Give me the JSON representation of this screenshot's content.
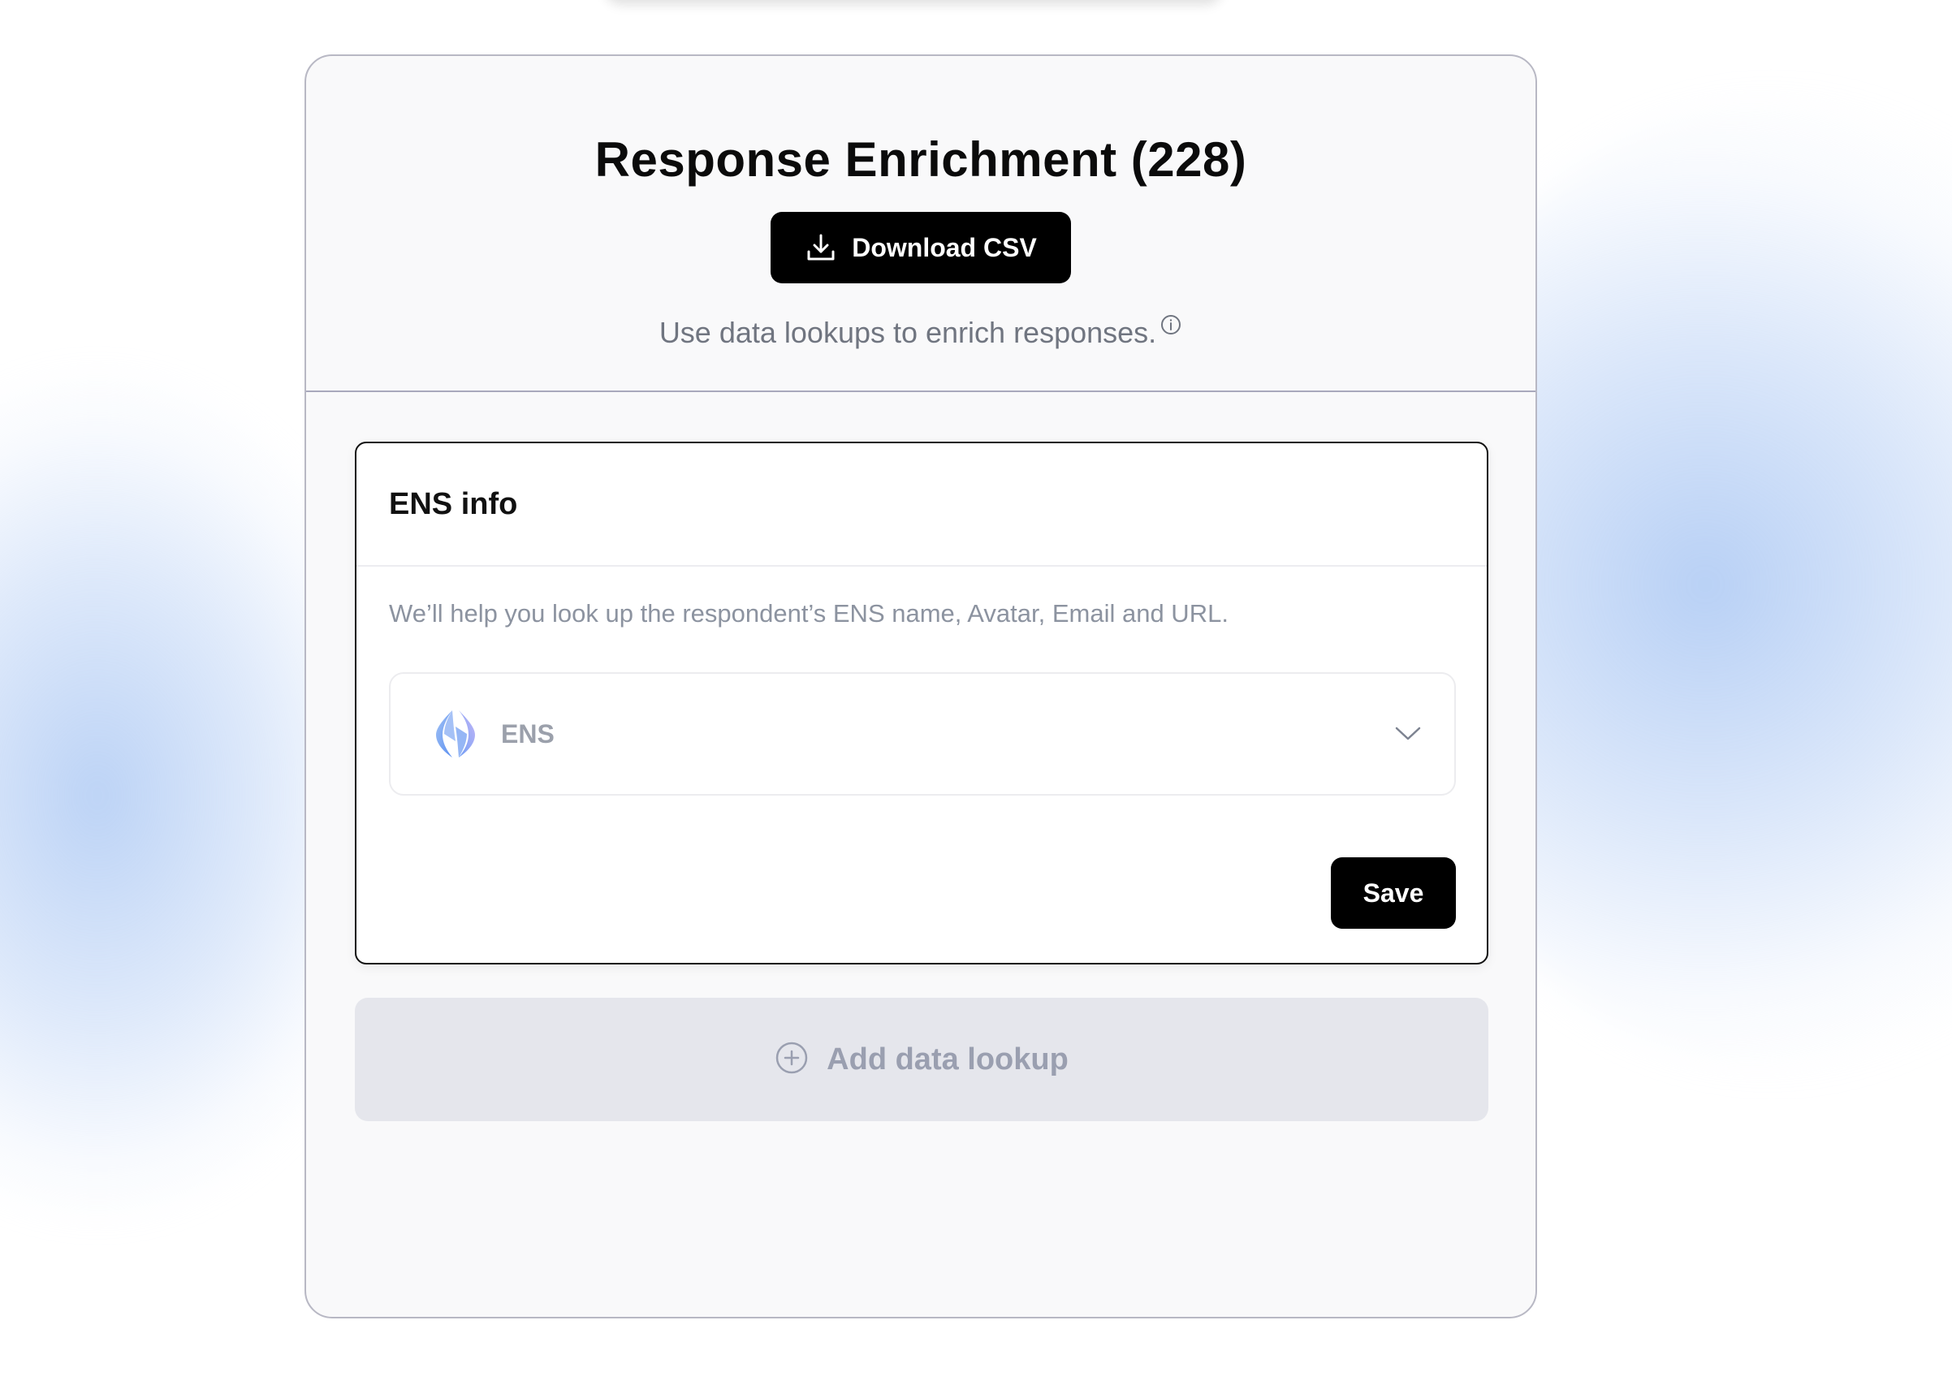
{
  "panel": {
    "title": "Response Enrichment (228)",
    "download_label": "Download CSV",
    "subtitle": "Use data lookups to enrich responses."
  },
  "lookup_card": {
    "title": "ENS info",
    "description": "We’ll help you look up the respondent’s ENS name, Avatar, Email and URL.",
    "selected_source": "ENS",
    "save_label": "Save"
  },
  "add_lookup": {
    "label": "Add data lookup"
  },
  "icons": {
    "download": "download-icon",
    "info": "info-icon",
    "ens_logo": "ens-logo-icon",
    "chevron": "chevron-down-icon",
    "add": "plus-circle-icon"
  },
  "colors": {
    "primary_button": "#000000",
    "accent_glow": "#b0cbf4",
    "muted_text": "#8c93a0"
  }
}
